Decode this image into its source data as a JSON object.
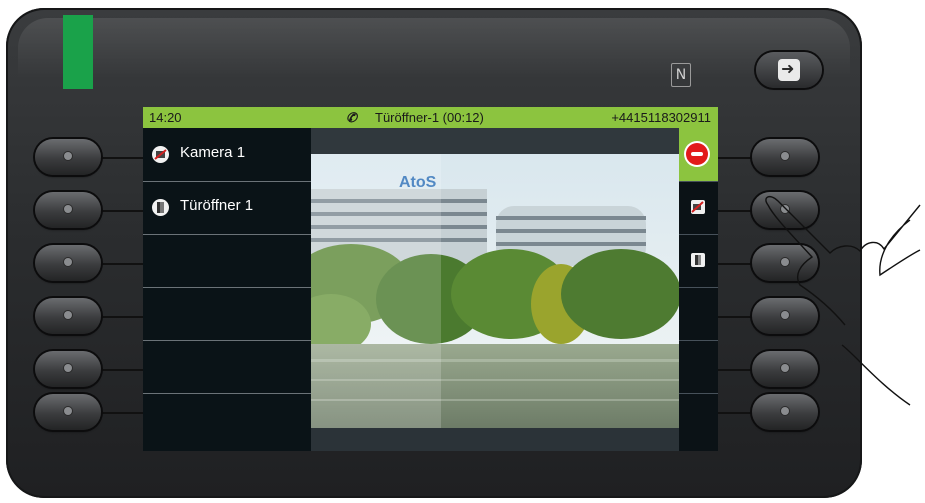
{
  "device": {
    "led_color": "#1aa24a",
    "nfc_icon": "N",
    "logout_icon": "logout-arrow-icon"
  },
  "statusbar": {
    "time": "14:20",
    "call_icon": "phone-ringing-icon",
    "call_glyph": "✆",
    "call_info": "Türöffner-1 (00:12)",
    "number": "+4415118302911",
    "color": "#8cc43f"
  },
  "list": [
    {
      "label": "Kamera 1",
      "icon": "camera-off-icon"
    },
    {
      "label": "Türöffner 1",
      "icon": "door-icon"
    },
    {
      "label": "",
      "icon": ""
    },
    {
      "label": "",
      "icon": ""
    },
    {
      "label": "",
      "icon": ""
    },
    {
      "label": "",
      "icon": ""
    }
  ],
  "video": {
    "logo_text": "AtoS"
  },
  "sidebar": [
    {
      "icon": "hang-up-icon",
      "active": true
    },
    {
      "icon": "camera-off-icon",
      "active": false
    },
    {
      "icon": "door-icon",
      "active": false
    }
  ]
}
